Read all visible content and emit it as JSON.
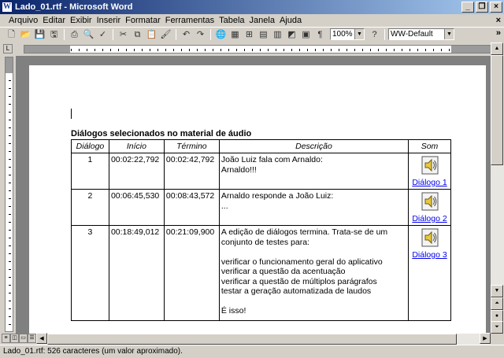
{
  "window": {
    "title": "Lado_01.rtf - Microsoft Word"
  },
  "menu": [
    "Arquivo",
    "Editar",
    "Exibir",
    "Inserir",
    "Formatar",
    "Ferramentas",
    "Tabela",
    "Janela",
    "Ajuda"
  ],
  "toolbar": {
    "zoom": "100%",
    "style": "WW-Default"
  },
  "document": {
    "heading": "Diálogos selecionados no material de áudio",
    "table": {
      "headers": [
        "Diálogo",
        "Início",
        "Término",
        "Descrição",
        "Som"
      ],
      "rows": [
        {
          "num": "1",
          "start": "00:02:22,792",
          "end": "00:02:42,792",
          "desc": [
            "João Luiz fala com Arnaldo:",
            "Arnaldo!!!"
          ],
          "sound": "Diálogo 1"
        },
        {
          "num": "2",
          "start": "00:06:45,530",
          "end": "00:08:43,572",
          "desc": [
            "Arnaldo responde a João Luiz:",
            "..."
          ],
          "sound": "Diálogo 2"
        },
        {
          "num": "3",
          "start": "00:18:49,012",
          "end": "00:21:09,900",
          "desc": [
            "A edição de diálogos termina. Trata-se de um",
            "conjunto de testes para:",
            "",
            "verificar o funcionamento geral do aplicativo",
            "verificar a questão da acentuação",
            "verificar a questão de múltiplos parágrafos",
            "testar a geração automatizada de laudos",
            "",
            "É isso!"
          ],
          "sound": "Diálogo 3"
        }
      ]
    }
  },
  "status": {
    "text": "Lado_01.rtf: 526 caracteres (um valor aproximado)."
  }
}
